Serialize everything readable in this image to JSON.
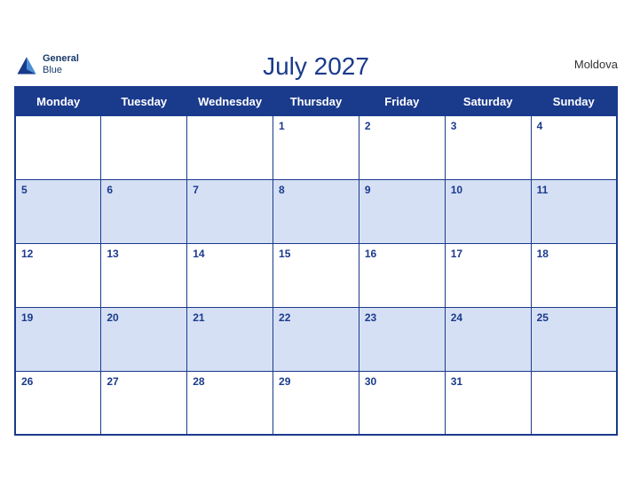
{
  "header": {
    "title": "July 2027",
    "country": "Moldova",
    "logo": {
      "line1": "General",
      "line2": "Blue"
    }
  },
  "weekdays": [
    "Monday",
    "Tuesday",
    "Wednesday",
    "Thursday",
    "Friday",
    "Saturday",
    "Sunday"
  ],
  "weeks": [
    [
      null,
      null,
      null,
      1,
      2,
      3,
      4
    ],
    [
      5,
      6,
      7,
      8,
      9,
      10,
      11
    ],
    [
      12,
      13,
      14,
      15,
      16,
      17,
      18
    ],
    [
      19,
      20,
      21,
      22,
      23,
      24,
      25
    ],
    [
      26,
      27,
      28,
      29,
      30,
      31,
      null
    ]
  ]
}
